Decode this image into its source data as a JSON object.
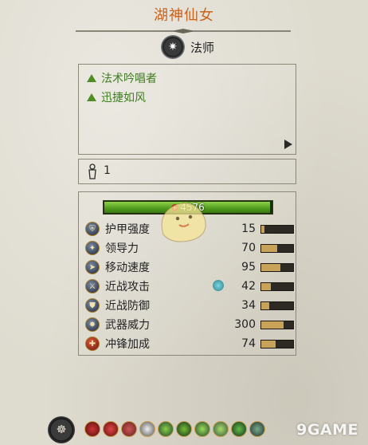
{
  "unit_name": "湖神仙女",
  "unit_class": {
    "label": "法师",
    "icon": "mage-star-icon"
  },
  "traits": [
    {
      "label": "法术吟唱者"
    },
    {
      "label": "迅捷如风"
    }
  ],
  "unit_count": "1",
  "health": {
    "value": "4576",
    "fill_fraction": 0.99,
    "color": "#5aa82a"
  },
  "stats": [
    {
      "label": "护甲强度",
      "value": "15",
      "bar_fraction": 0.1,
      "icon": "armor-icon"
    },
    {
      "label": "领导力",
      "value": "70",
      "bar_fraction": 0.5,
      "icon": "leadership-icon"
    },
    {
      "label": "移动速度",
      "value": "95",
      "bar_fraction": 0.6,
      "icon": "speed-icon"
    },
    {
      "label": "近战攻击",
      "value": "42",
      "bar_fraction": 0.3,
      "icon": "melee-attack-icon",
      "buff": true
    },
    {
      "label": "近战防御",
      "value": "34",
      "bar_fraction": 0.25,
      "icon": "melee-defense-icon"
    },
    {
      "label": "武器威力",
      "value": "300",
      "bar_fraction": 0.7,
      "icon": "weapon-strength-icon"
    },
    {
      "label": "冲锋加成",
      "value": "74",
      "bar_fraction": 0.45,
      "icon": "charge-bonus-icon"
    }
  ],
  "watermark": "9GAME",
  "colors": {
    "title": "#c8621f",
    "trait": "#3e7d1e",
    "stat_bar_fill": "#c9a25a"
  }
}
